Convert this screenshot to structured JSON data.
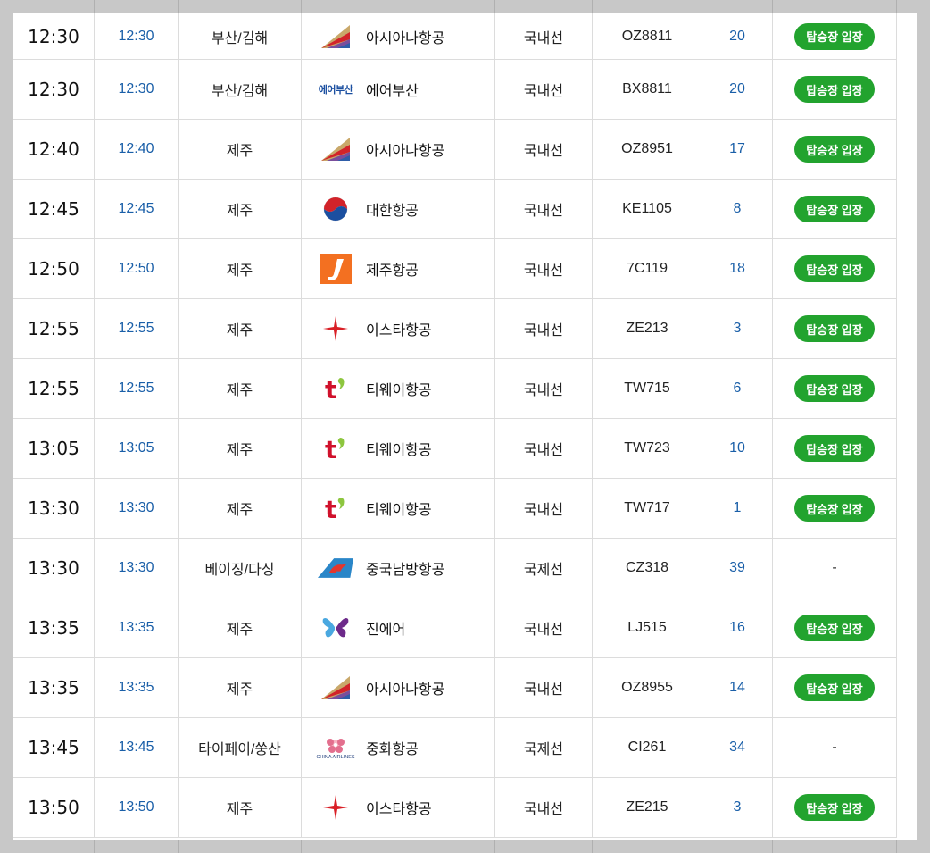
{
  "flights": [
    {
      "scheduled": "12:30",
      "changed": "12:30",
      "destination": "부산/김해",
      "airline": "아시아나항공",
      "logo": "asiana-logo",
      "type": "국내선",
      "flight": "OZ8811",
      "gate": "20",
      "status": "탑승장 입장"
    },
    {
      "scheduled": "12:30",
      "changed": "12:30",
      "destination": "부산/김해",
      "airline": "에어부산",
      "logo": "airbusan-logo",
      "logo_text": "에어부산",
      "type": "국내선",
      "flight": "BX8811",
      "gate": "20",
      "status": "탑승장 입장"
    },
    {
      "scheduled": "12:40",
      "changed": "12:40",
      "destination": "제주",
      "airline": "아시아나항공",
      "logo": "asiana-logo",
      "type": "국내선",
      "flight": "OZ8951",
      "gate": "17",
      "status": "탑승장 입장"
    },
    {
      "scheduled": "12:45",
      "changed": "12:45",
      "destination": "제주",
      "airline": "대한항공",
      "logo": "koreanair-logo",
      "type": "국내선",
      "flight": "KE1105",
      "gate": "8",
      "status": "탑승장 입장"
    },
    {
      "scheduled": "12:50",
      "changed": "12:50",
      "destination": "제주",
      "airline": "제주항공",
      "logo": "jejuair-logo",
      "type": "국내선",
      "flight": "7C119",
      "gate": "18",
      "status": "탑승장 입장"
    },
    {
      "scheduled": "12:55",
      "changed": "12:55",
      "destination": "제주",
      "airline": "이스타항공",
      "logo": "eastar-logo",
      "type": "국내선",
      "flight": "ZE213",
      "gate": "3",
      "status": "탑승장 입장"
    },
    {
      "scheduled": "12:55",
      "changed": "12:55",
      "destination": "제주",
      "airline": "티웨이항공",
      "logo": "tway-logo",
      "type": "국내선",
      "flight": "TW715",
      "gate": "6",
      "status": "탑승장 입장"
    },
    {
      "scheduled": "13:05",
      "changed": "13:05",
      "destination": "제주",
      "airline": "티웨이항공",
      "logo": "tway-logo",
      "type": "국내선",
      "flight": "TW723",
      "gate": "10",
      "status": "탑승장 입장"
    },
    {
      "scheduled": "13:30",
      "changed": "13:30",
      "destination": "제주",
      "airline": "티웨이항공",
      "logo": "tway-logo",
      "type": "국내선",
      "flight": "TW717",
      "gate": "1",
      "status": "탑승장 입장"
    },
    {
      "scheduled": "13:30",
      "changed": "13:30",
      "destination": "베이징/다싱",
      "airline": "중국남방항공",
      "logo": "chinasouthern-logo",
      "type": "국제선",
      "flight": "CZ318",
      "gate": "39",
      "status": "-"
    },
    {
      "scheduled": "13:35",
      "changed": "13:35",
      "destination": "제주",
      "airline": "진에어",
      "logo": "jinair-logo",
      "type": "국내선",
      "flight": "LJ515",
      "gate": "16",
      "status": "탑승장 입장"
    },
    {
      "scheduled": "13:35",
      "changed": "13:35",
      "destination": "제주",
      "airline": "아시아나항공",
      "logo": "asiana-logo",
      "type": "국내선",
      "flight": "OZ8955",
      "gate": "14",
      "status": "탑승장 입장"
    },
    {
      "scheduled": "13:45",
      "changed": "13:45",
      "destination": "타이페이/쑹산",
      "airline": "중화항공",
      "logo": "chinaairlines-logo",
      "logo_text": "CHINA AIRLINES",
      "type": "국제선",
      "flight": "CI261",
      "gate": "34",
      "status": "-"
    },
    {
      "scheduled": "13:50",
      "changed": "13:50",
      "destination": "제주",
      "airline": "이스타항공",
      "logo": "eastar-logo",
      "type": "국내선",
      "flight": "ZE215",
      "gate": "3",
      "status": "탑승장 입장"
    }
  ],
  "colors": {
    "accent_blue": "#1a5fa8",
    "button_green": "#22a32e",
    "background_gray": "#c8c8c8"
  }
}
